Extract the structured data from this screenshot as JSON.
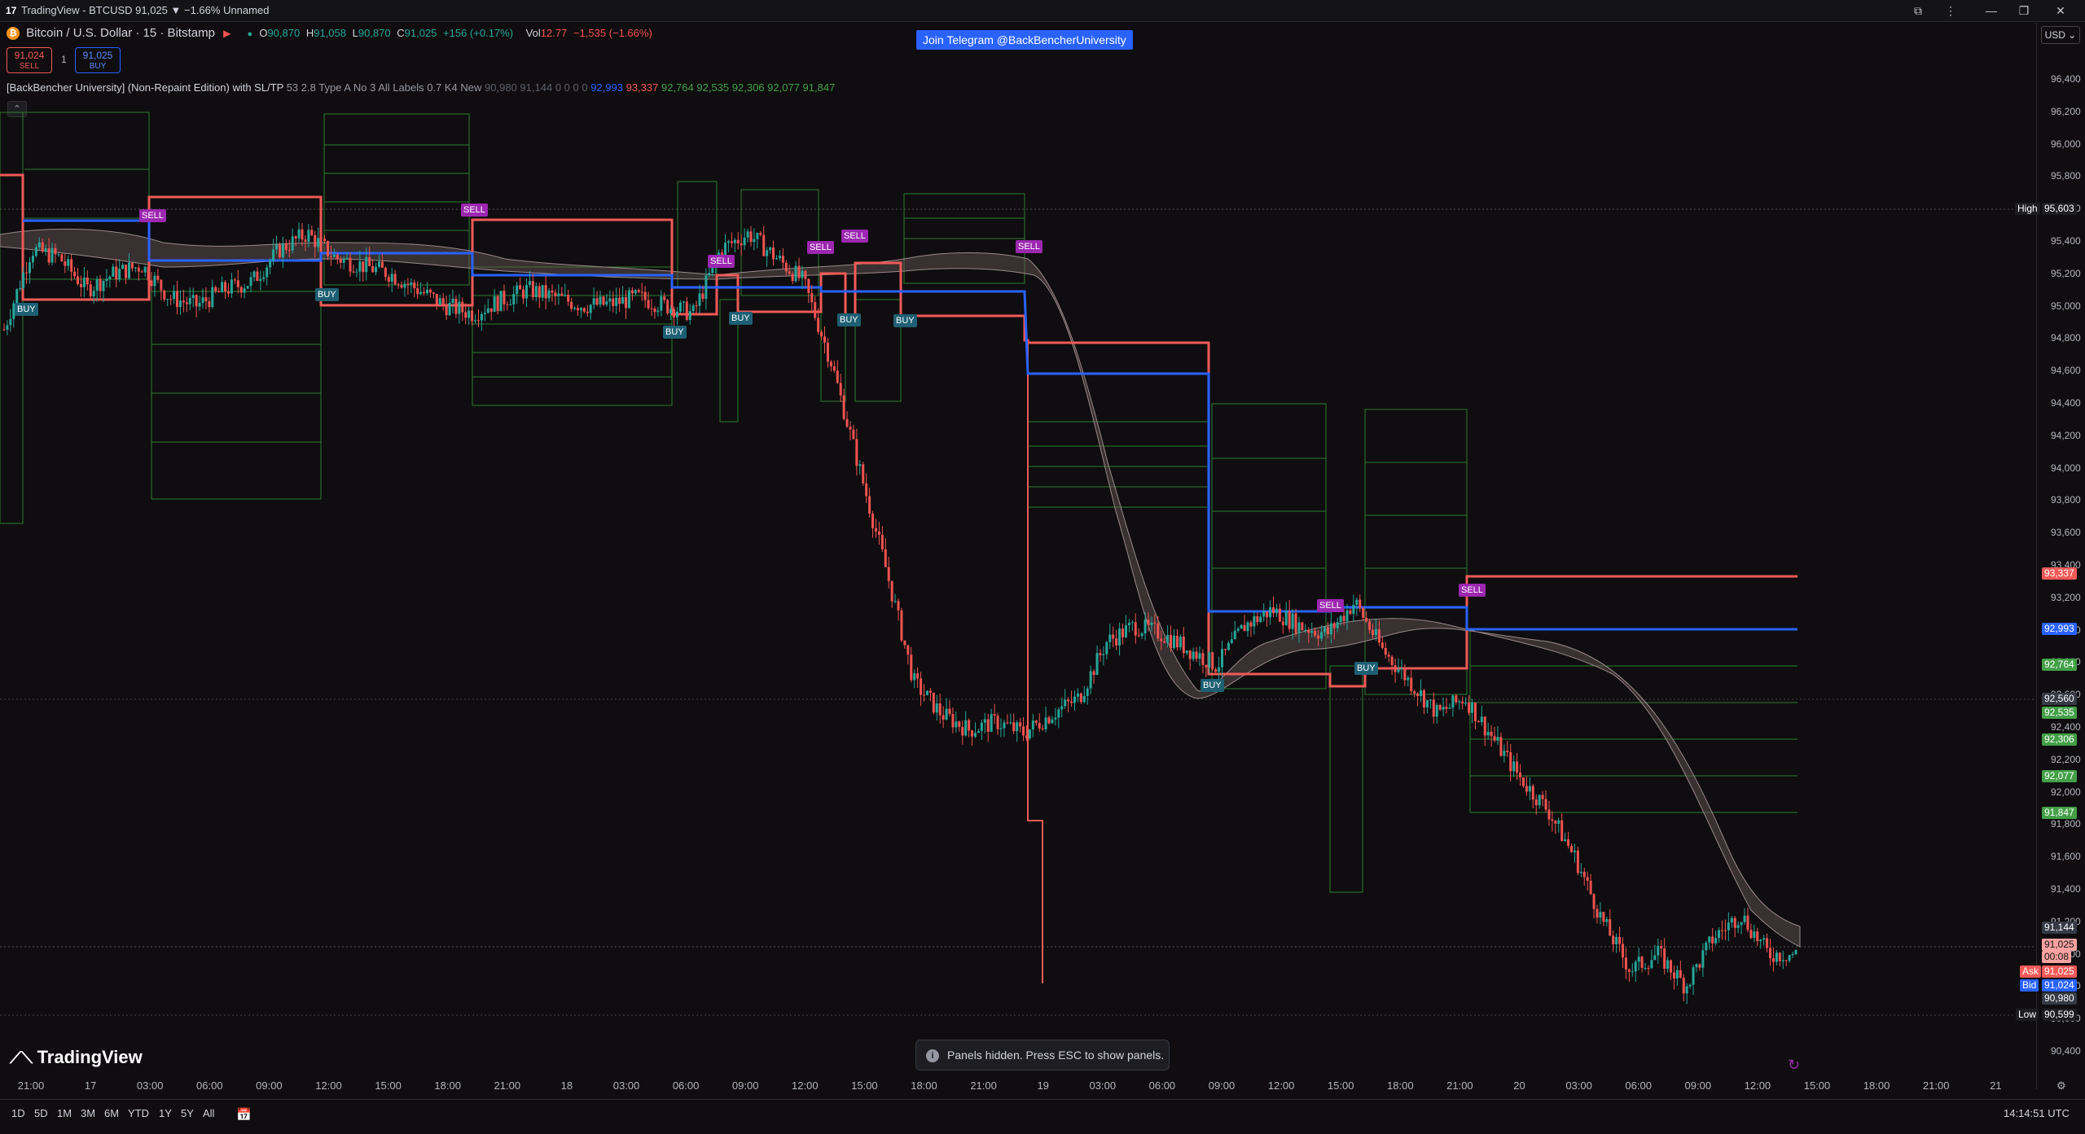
{
  "window": {
    "title": "TradingView - BTCUSD 91,025 ▼ −1.66% Unnamed",
    "controls": [
      "⧉",
      "⋮",
      "—",
      "❐",
      "✕"
    ]
  },
  "symbol": {
    "name": "Bitcoin / U.S. Dollar · 15 · Bitstamp",
    "open_label": "O",
    "open": "90,870",
    "high_label": "H",
    "high": "91,058",
    "low_label": "L",
    "low": "90,870",
    "close_label": "C",
    "close": "91,025",
    "change": "+156 (+0.17%)",
    "vol_label": "Vol",
    "vol": "12.77",
    "vol_change": "−1,535 (−1.66%)"
  },
  "trade": {
    "sell_price": "91,024",
    "sell_label": "SELL",
    "buy_price": "91,025",
    "buy_label": "BUY",
    "spread": "1"
  },
  "indicator": {
    "name": "[BackBencher University] (Non-Repaint Edition) with SL/TP",
    "params": "53 2.8 Type A No 3 All Labels 0.7 K4 New",
    "v1": "90,980",
    "v2": "91,144",
    "zeros": "0 0 0 0",
    "v3": "92,993",
    "v4": "93,337",
    "v5": "92,764",
    "v6": "92,535",
    "v7": "92,306",
    "v8": "92,077",
    "v9": "91,847"
  },
  "telegram": "Join Telegram @BackBencherUniversity",
  "price_axis": {
    "currency": "USD ⌄",
    "ticks": [
      "96,400",
      "96,200",
      "96,000",
      "95,800",
      "95,600",
      "95,400",
      "95,200",
      "95,000",
      "94,800",
      "94,600",
      "94,400",
      "94,200",
      "94,000",
      "93,800",
      "93,600",
      "93,400",
      "93,200",
      "93,000",
      "92,800",
      "92,600",
      "92,400",
      "92,200",
      "92,000",
      "91,800",
      "91,600",
      "91,400",
      "91,200",
      "91,000",
      "90,800",
      "90,600",
      "90,400"
    ],
    "high_label": "High",
    "high_value": "95,603",
    "low_label": "Low",
    "low_value": "90,599",
    "ask_label": "Ask",
    "ask_value": "91,025",
    "bid_label": "Bid",
    "bid_value": "91,024",
    "last_value": "91,025",
    "countdown": "00:08",
    "tp_red": "93,337",
    "sl_blue": "92,993",
    "tp1": "92,764",
    "tp2": "92,535",
    "tp3": "92,306",
    "tp4": "92,077",
    "tp5": "91,847",
    "mid": "92,560",
    "ind1": "91,144",
    "ind2": "90,980",
    "colors": {
      "red": "#f05a57",
      "blue": "#2962ff",
      "green": "#43a047",
      "grey": "#363a45"
    }
  },
  "time_axis": [
    "21:00",
    "17",
    "03:00",
    "06:00",
    "09:00",
    "12:00",
    "15:00",
    "18:00",
    "21:00",
    "18",
    "03:00",
    "06:00",
    "09:00",
    "12:00",
    "15:00",
    "18:00",
    "21:00",
    "19",
    "03:00",
    "06:00",
    "09:00",
    "12:00",
    "15:00",
    "18:00",
    "21:00",
    "20",
    "03:00",
    "06:00",
    "09:00",
    "12:00",
    "15:00",
    "18:00",
    "21:00",
    "21"
  ],
  "ranges": [
    "1D",
    "5D",
    "1M",
    "3M",
    "6M",
    "YTD",
    "1Y",
    "5Y",
    "All"
  ],
  "clock": "14:14:51 UTC",
  "brand": "TradingView",
  "toast": "Panels hidden. Press ESC to show panels.",
  "signals": {
    "buy": "BUY",
    "sell": "SELL"
  },
  "chart_data": {
    "type": "candlestick",
    "symbol": "BTCUSD",
    "interval": "15",
    "ylim": [
      90400,
      96500
    ],
    "levels": {
      "tp_red": 93337,
      "entry_blue": 92993,
      "targets": [
        92764,
        92535,
        92306,
        92077,
        91847
      ],
      "session_high": 95603,
      "session_low": 90599,
      "last": 91025
    },
    "close_path": [
      94900,
      95400,
      95350,
      95150,
      95250,
      95300,
      95100,
      95050,
      95150,
      95200,
      95400,
      95500,
      95350,
      95300,
      95250,
      95150,
      95050,
      95000,
      95080,
      95150,
      95100,
      95050,
      95060,
      95100,
      95050,
      95000,
      95400,
      95500,
      95350,
      95200,
      94700,
      94050,
      93400,
      92700,
      92500,
      92400,
      92450,
      92380,
      92500,
      92600,
      92950,
      93050,
      93000,
      92900,
      92800,
      93050,
      93150,
      93050,
      93000,
      93200,
      92900,
      92700,
      92500,
      92600,
      92350,
      92100,
      91900,
      91600,
      91200,
      90900,
      91000,
      90800,
      91100,
      91250,
      91000,
      91000
    ]
  }
}
